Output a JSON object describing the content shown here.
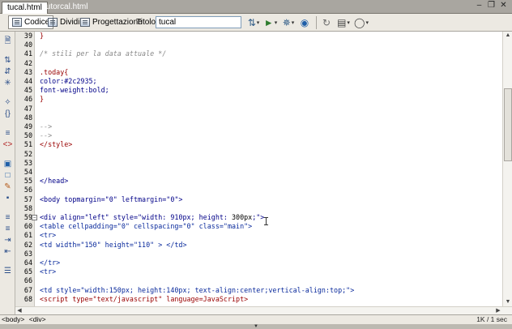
{
  "tabs": [
    {
      "label": "tucal.html",
      "active": true
    },
    {
      "label": "tutorcal.html",
      "active": false
    }
  ],
  "window_controls": [
    "minimize-icon",
    "restore-icon",
    "close-icon"
  ],
  "toolbar": {
    "view_code_label": "Codice",
    "view_split_label": "Dividi",
    "view_design_label": "Progettazione",
    "title_label": "Titolo:",
    "title_value": "tucal",
    "icons": [
      "file-management-icon",
      "preview-browser-icon",
      "debug-icon",
      "check-page-icon",
      "refresh-icon",
      "view-options-icon",
      "visual-aids-icon"
    ]
  },
  "left_toolbar_icons": [
    "open-documents-icon",
    "collapse-full-tag-icon",
    "collapse-selection-icon",
    "expand-all-icon",
    "select-parent-tag-icon",
    "balance-braces-icon",
    "line-numbers-icon",
    "highlight-invalid-icon",
    "syntax-error-icon",
    "apply-comment-icon",
    "remove-comment-icon",
    "wrap-tag-icon",
    "recent-snippets-icon",
    "move-css-icon",
    "indent-icon",
    "outdent-icon",
    "format-source-icon"
  ],
  "code_lines": [
    {
      "num": "39",
      "segments": [
        {
          "t": "}",
          "c": "css"
        }
      ]
    },
    {
      "num": "40",
      "segments": []
    },
    {
      "num": "41",
      "segments": [
        {
          "t": "/* stili per la data attuale */",
          "c": "cmt"
        }
      ]
    },
    {
      "num": "42",
      "segments": []
    },
    {
      "num": "43",
      "segments": [
        {
          "t": ".today{",
          "c": "css"
        }
      ]
    },
    {
      "num": "44",
      "segments": [
        {
          "t": "color:#2c2935;",
          "c": "tag2"
        }
      ]
    },
    {
      "num": "45",
      "segments": [
        {
          "t": "font-weight:bold;",
          "c": "tag2"
        }
      ]
    },
    {
      "num": "46",
      "segments": [
        {
          "t": "}",
          "c": "css"
        }
      ]
    },
    {
      "num": "47",
      "segments": []
    },
    {
      "num": "48",
      "segments": []
    },
    {
      "num": "49",
      "segments": [
        {
          "t": "-->",
          "c": "cmt"
        }
      ]
    },
    {
      "num": "50",
      "segments": [
        {
          "t": "-->",
          "c": "cmt"
        }
      ]
    },
    {
      "num": "51",
      "segments": [
        {
          "t": "</style>",
          "c": "tag"
        }
      ]
    },
    {
      "num": "52",
      "segments": []
    },
    {
      "num": "53",
      "segments": []
    },
    {
      "num": "54",
      "segments": []
    },
    {
      "num": "55",
      "segments": [
        {
          "t": "</head>",
          "c": "tag2"
        }
      ]
    },
    {
      "num": "56",
      "segments": []
    },
    {
      "num": "57",
      "segments": [
        {
          "t": "<body topmargin=\"0\" leftmargin=\"0\">",
          "c": "tag2"
        }
      ]
    },
    {
      "num": "58",
      "segments": []
    },
    {
      "num": "59",
      "fold": true,
      "segments": [
        {
          "t": "<div align=\"left\" style=\"width: 910px; height: ",
          "c": "tag2"
        },
        {
          "t": "300px",
          "c": "sel"
        },
        {
          "t": ";\">",
          "c": "tag2"
        }
      ]
    },
    {
      "num": "60",
      "segments": [
        {
          "t": "<table cellpadding=\"0\" cellspacing=\"0\" class=\"main\">",
          "c": "attr"
        }
      ]
    },
    {
      "num": "61",
      "segments": [
        {
          "t": "<tr>",
          "c": "attr"
        }
      ]
    },
    {
      "num": "62",
      "segments": [
        {
          "t": "<td width=\"150\" height=\"110\" > </td>",
          "c": "attr"
        }
      ]
    },
    {
      "num": "63",
      "segments": []
    },
    {
      "num": "64",
      "segments": [
        {
          "t": "</tr>",
          "c": "attr"
        }
      ]
    },
    {
      "num": "65",
      "segments": [
        {
          "t": "<tr>",
          "c": "attr"
        }
      ]
    },
    {
      "num": "66",
      "segments": []
    },
    {
      "num": "67",
      "segments": [
        {
          "t": "<td style=\"width:150px; height:140px; text-align:center;vertical-align:top;\">",
          "c": "attr"
        }
      ]
    },
    {
      "num": "68",
      "segments": [
        {
          "t": "<script type=\"text/javascript\" language=JavaScript>",
          "c": "tag"
        }
      ]
    }
  ],
  "status_bar": {
    "tags": [
      "<body>",
      "<div>"
    ],
    "info": "1K / 1 sec"
  }
}
